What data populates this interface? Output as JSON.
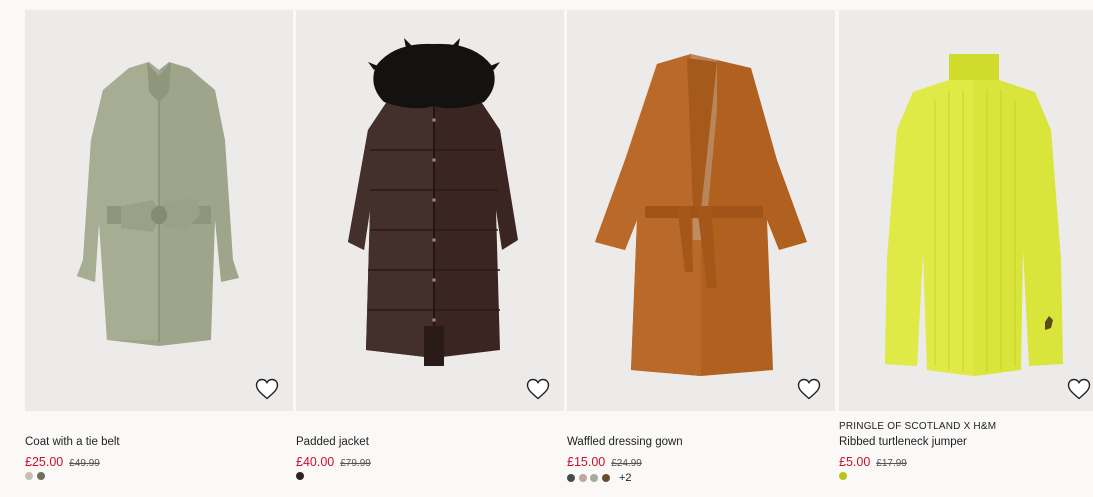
{
  "products": [
    {
      "brand": "",
      "title": "Coat with a tie belt",
      "price": "£25.00",
      "old_price": "£49.99",
      "image_alt": "sage green belted coat",
      "swatches": [
        "#c8bfb4",
        "#6e7058"
      ],
      "more_colors": ""
    },
    {
      "brand": "",
      "title": "Padded jacket",
      "price": "£40.00",
      "old_price": "£79.99",
      "image_alt": "dark brown long padded jacket with faux fur hood",
      "swatches": [
        "#2b2320"
      ],
      "more_colors": ""
    },
    {
      "brand": "",
      "title": "Waffled dressing gown",
      "price": "£15.00",
      "old_price": "£24.99",
      "image_alt": "rust brown waffled dressing gown",
      "swatches": [
        "#4a4a4a",
        "#c0a8a2",
        "#a8a8a2",
        "#6b4a2e"
      ],
      "more_colors": "+2"
    },
    {
      "brand": "PRINGLE OF SCOTLAND X H&M",
      "title": "Ribbed turtleneck jumper",
      "price": "£5.00",
      "old_price": "£17.99",
      "image_alt": "neon yellow ribbed turtleneck jumper",
      "swatches": [
        "#b7c41a"
      ],
      "more_colors": ""
    }
  ],
  "colors": {
    "sale_price": "#c8102e",
    "image_bg": "#ecebe9"
  },
  "icons": {
    "favourite": "heart-outline-icon"
  }
}
